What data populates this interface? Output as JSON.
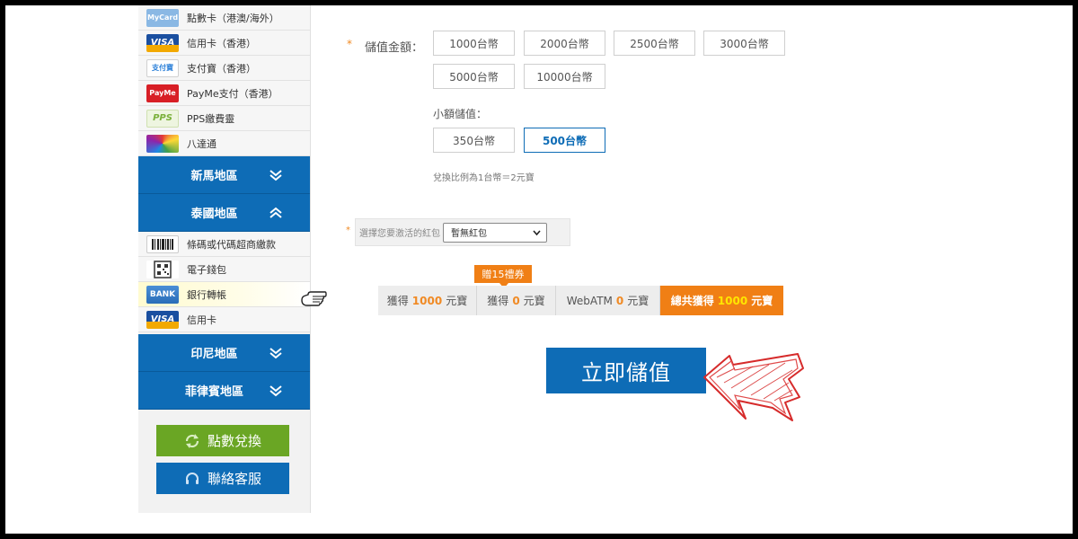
{
  "sidebar": {
    "top_items": [
      {
        "label": "點數卡（港澳/海外）",
        "logo": "mycard-logo",
        "logo_text": "MyCard",
        "color": "#7fb2de"
      },
      {
        "label": "信用卡（香港）",
        "logo": "visa-logo",
        "logo_text": "VISA",
        "color": "#1a4fa0"
      },
      {
        "label": "支付寶（香港）",
        "logo": "alipay-logo",
        "logo_text": "支付寶",
        "color": "#2a7fd8"
      },
      {
        "label": "PayMe支付（香港）",
        "logo": "payme-logo",
        "logo_text": "PayMe",
        "color": "#d81f26"
      },
      {
        "label": "PPS繳費靈",
        "logo": "pps-logo",
        "logo_text": "PPS",
        "color": "#8bc34a"
      },
      {
        "label": "八達通",
        "logo": "octopus-logo",
        "logo_text": "8",
        "color": "#555"
      }
    ],
    "regions": {
      "malaysia": "新馬地區",
      "thailand": "泰國地區",
      "indonesia": "印尼地區",
      "philippines": "菲律賓地區"
    },
    "thai_items": [
      {
        "label": "條碼或代碼超商繳款",
        "logo": "barcode-logo"
      },
      {
        "label": "電子錢包",
        "logo": "qrcode-logo"
      },
      {
        "label": "銀行轉帳",
        "logo": "bank-logo",
        "logo_text": "BANK"
      },
      {
        "label": "信用卡",
        "logo": "visa-logo",
        "logo_text": "VISA"
      }
    ],
    "exchange_button": "點數兌換",
    "support_button": "聯絡客服"
  },
  "main": {
    "amount_label": "儲值金額：",
    "amounts": [
      "1000台幣",
      "2000台幣",
      "2500台幣",
      "3000台幣",
      "5000台幣",
      "10000台幣"
    ],
    "small_label": "小額儲值：",
    "small_amounts": [
      "350台幣",
      "500台幣"
    ],
    "selected_amount": "500台幣",
    "ratio_note": "兌換比例為1台幣＝2元寶",
    "redpacket_label": "選擇您要激活的紅包",
    "redpacket_value": "暫無紅包",
    "badge": "贈15禮券",
    "summary": {
      "get_prefix": "獲得",
      "get_value": "1000",
      "get_suffix": "元寶",
      "bonus_prefix": "獲得",
      "bonus_value": "0",
      "bonus_suffix": "元寶",
      "atm_prefix": "WebATM",
      "atm_value": "0",
      "atm_suffix": "元寶",
      "total_prefix": "總共獲得",
      "total_value": "1000",
      "total_suffix": "元寶"
    },
    "submit": "立即儲值"
  },
  "colors": {
    "brand_blue": "#0e6cb6",
    "accent_orange": "#f07f15",
    "highlight_yellow": "#ffe600",
    "exchange_green": "#6aa624"
  }
}
